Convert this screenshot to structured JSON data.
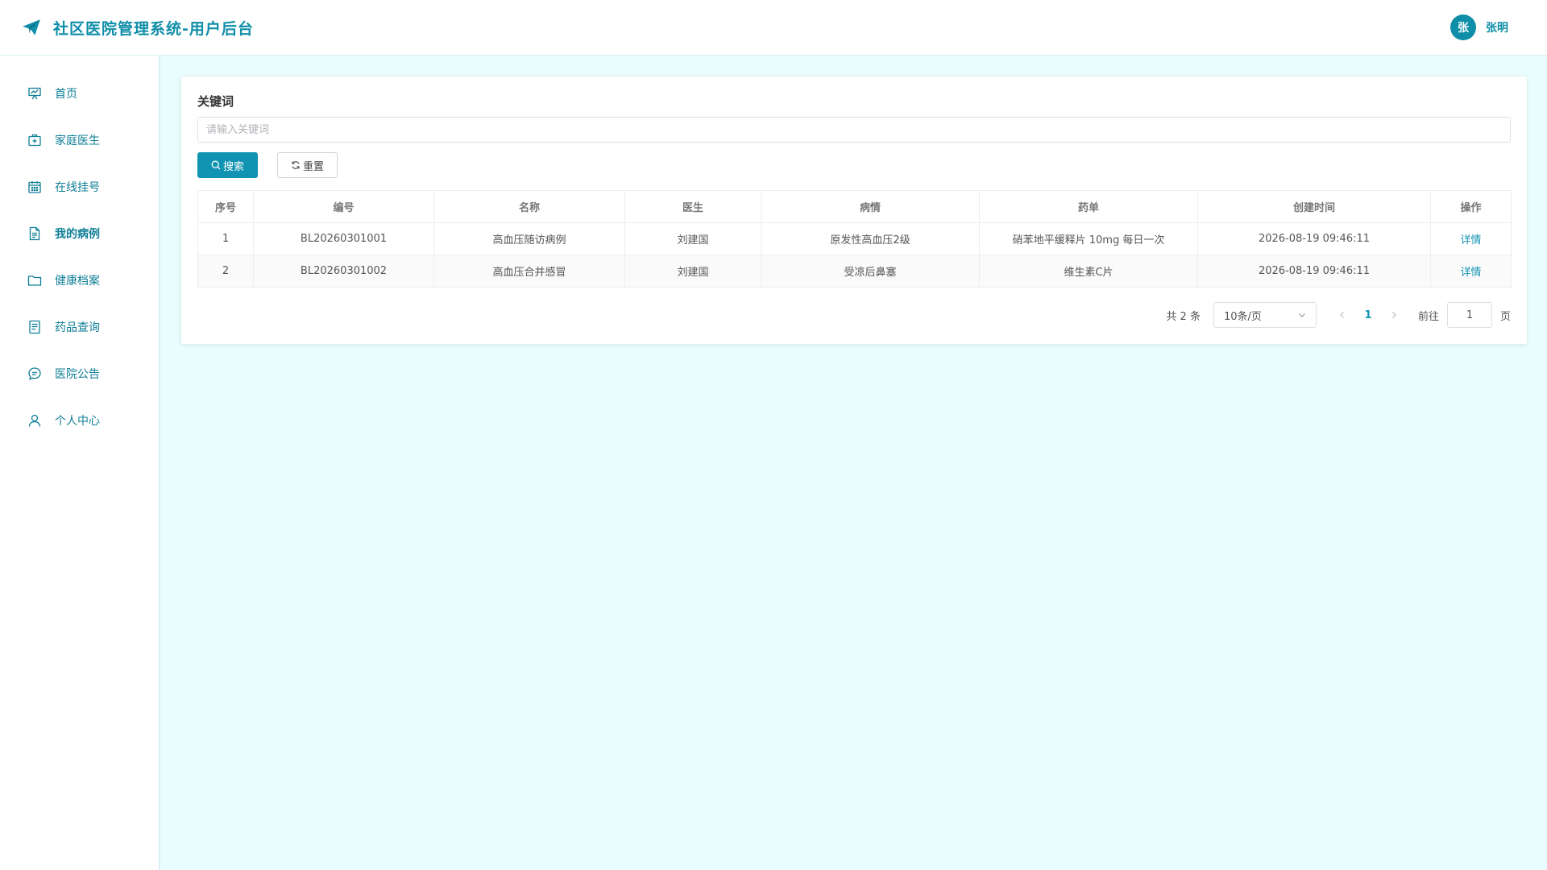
{
  "header": {
    "title": "社区医院管理系统-用户后台",
    "user_avatar": "张",
    "user_name": "张明"
  },
  "colors": {
    "accent": "#0e8ea8",
    "primary_button": "#1193b2",
    "background": "#eafdfe"
  },
  "sidebar": {
    "items": [
      {
        "label": "首页",
        "icon": "presentation-chart-icon"
      },
      {
        "label": "家庭医生",
        "icon": "medical-kit-icon"
      },
      {
        "label": "在线挂号",
        "icon": "calendar-icon"
      },
      {
        "label": "我的病例",
        "icon": "document-icon",
        "active": true
      },
      {
        "label": "健康档案",
        "icon": "folder-icon"
      },
      {
        "label": "药品查询",
        "icon": "list-document-icon"
      },
      {
        "label": "医院公告",
        "icon": "chat-bubble-icon"
      },
      {
        "label": "个人中心",
        "icon": "user-icon"
      }
    ]
  },
  "filter": {
    "label": "关键词",
    "placeholder": "请输入关键词",
    "value": "",
    "search_label": "搜索",
    "reset_label": "重置"
  },
  "table": {
    "columns": [
      "序号",
      "编号",
      "名称",
      "医生",
      "病情",
      "药单",
      "创建时间",
      "操作"
    ],
    "rows": [
      {
        "index": "1",
        "code": "BL20260301001",
        "name": "高血压随访病例",
        "doctor": "刘建国",
        "condition": "原发性高血压2级",
        "prescription": "硝苯地平缓释片 10mg 每日一次",
        "created": "2026-08-19 09:46:11",
        "action": "详情"
      },
      {
        "index": "2",
        "code": "BL20260301002",
        "name": "高血压合并感冒",
        "doctor": "刘建国",
        "condition": "受凉后鼻塞",
        "prescription": "维生素C片",
        "created": "2026-08-19 09:46:11",
        "action": "详情"
      }
    ]
  },
  "pagination": {
    "total_text": "共 2 条",
    "page_size": "10条/页",
    "current_page": "1",
    "goto_label": "前往",
    "goto_value": "1",
    "goto_suffix": "页"
  }
}
